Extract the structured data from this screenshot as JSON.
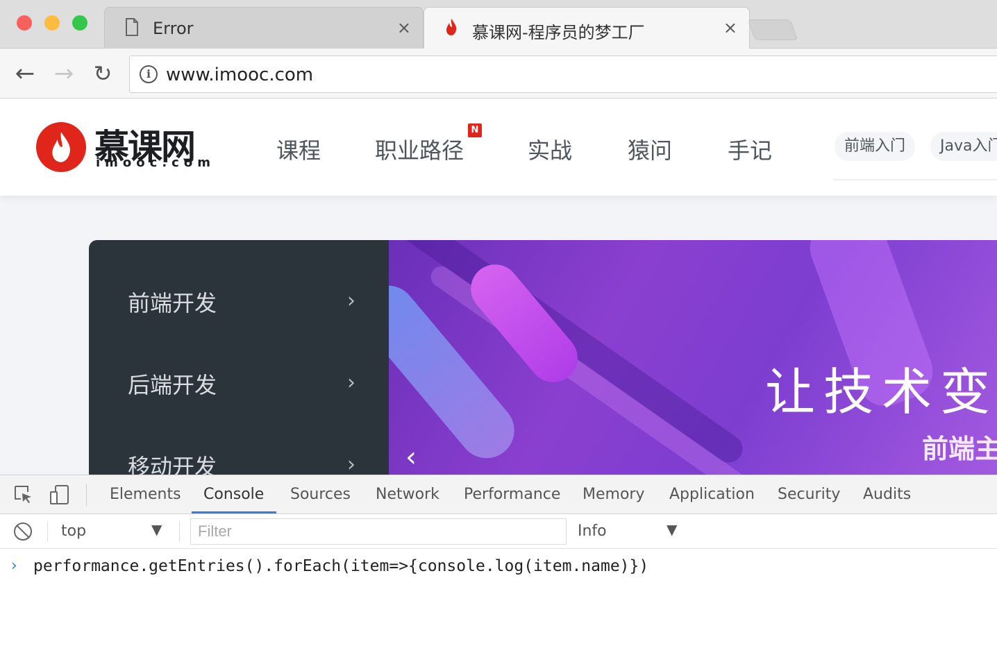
{
  "browser": {
    "tabs": [
      {
        "title": "Error",
        "icon": "document-icon",
        "active": false
      },
      {
        "title": "慕课网-程序员的梦工厂",
        "icon": "imooc-flame-icon",
        "active": true
      }
    ],
    "close_glyph": "×",
    "url": "www.imooc.com"
  },
  "site": {
    "logo_cn": "慕课网",
    "logo_en": "imooc.com",
    "brand_color": "#e0251b",
    "nav": [
      "课程",
      "职业路径",
      "实战",
      "猿问",
      "手记"
    ],
    "nav_badge": "N",
    "tags": [
      "前端入门",
      "Java入门"
    ],
    "categories": [
      "前端开发",
      "后端开发",
      "移动开发"
    ],
    "chevron": "›",
    "banner_headline": "让技术变",
    "banner_sub": "前端主",
    "banner_prev": "‹"
  },
  "devtools": {
    "tabs": [
      "Elements",
      "Console",
      "Sources",
      "Network",
      "Performance",
      "Memory",
      "Application",
      "Security",
      "Audits"
    ],
    "active_tab": "Console",
    "accent_color": "#3879d9",
    "context": "top",
    "filter_placeholder": "Filter",
    "level": "Info",
    "prompt": "›",
    "input": "performance.getEntries().forEach(item=>{console.log(item.name)})"
  }
}
